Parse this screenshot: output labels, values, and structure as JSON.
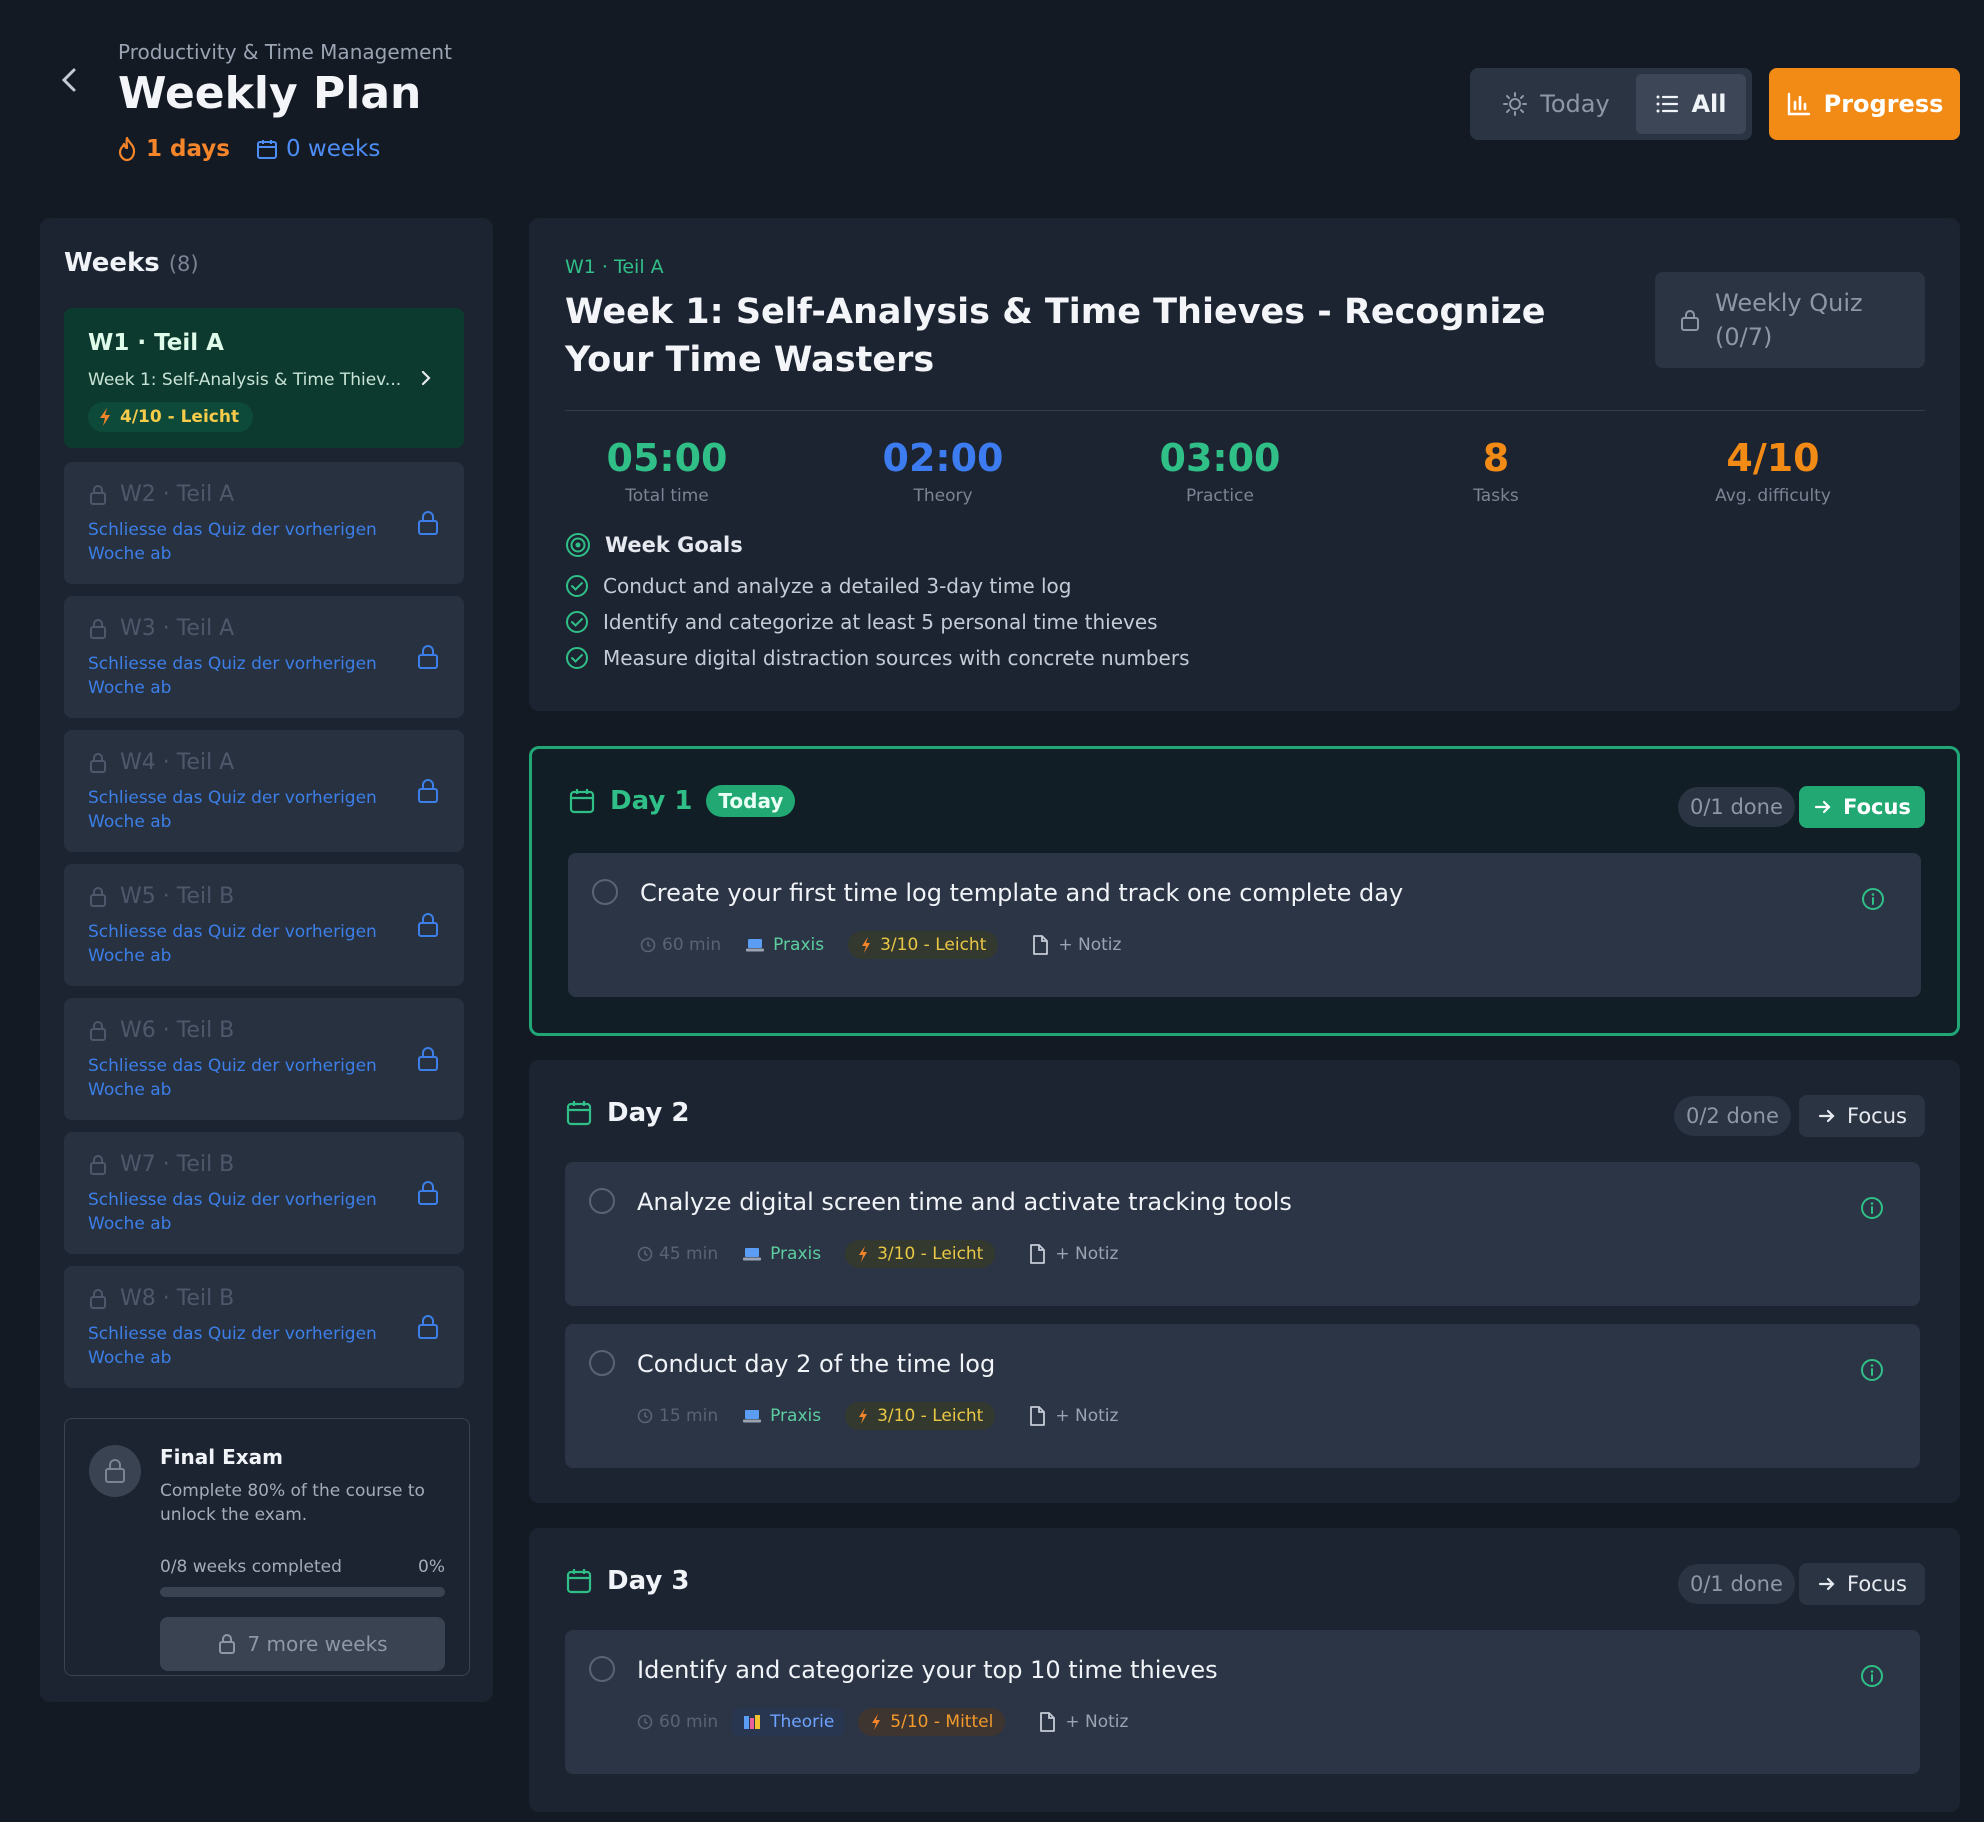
{
  "header": {
    "breadcrumb": "Productivity & Time Management",
    "title": "Weekly Plan",
    "streak_days": "1 days",
    "streak_weeks": "0 weeks",
    "toggle_today": "Today",
    "toggle_all": "All",
    "progress_label": "Progress"
  },
  "sidebar": {
    "heading": "Weeks",
    "count": "(8)",
    "active_week": {
      "title": "W1 · Teil A",
      "subtitle": "Week 1: Self-Analysis & Time Thiev...",
      "difficulty": "4/10 - Leicht"
    },
    "locked_weeks": [
      {
        "title": "W2 · Teil A",
        "desc": "Schliesse das Quiz der vorherigen Woche ab"
      },
      {
        "title": "W3 · Teil A",
        "desc": "Schliesse das Quiz der vorherigen Woche ab"
      },
      {
        "title": "W4 · Teil A",
        "desc": "Schliesse das Quiz der vorherigen Woche ab"
      },
      {
        "title": "W5 · Teil B",
        "desc": "Schliesse das Quiz der vorherigen Woche ab"
      },
      {
        "title": "W6 · Teil B",
        "desc": "Schliesse das Quiz der vorherigen Woche ab"
      },
      {
        "title": "W7 · Teil B",
        "desc": "Schliesse das Quiz der vorherigen Woche ab"
      },
      {
        "title": "W8 · Teil B",
        "desc": "Schliesse das Quiz der vorherigen Woche ab"
      }
    ],
    "final_exam": {
      "title": "Final Exam",
      "desc": "Complete 80% of the course to unlock the exam.",
      "progress_label": "0/8 weeks completed",
      "progress_pct": "0%",
      "progress_value": 0,
      "button": "7 more weeks"
    }
  },
  "overview": {
    "tag": "W1 · Teil A",
    "title": "Week 1: Self-Analysis & Time Thieves - Recognize Your Time Wasters",
    "quiz_label": "Weekly Quiz (0/7)",
    "stats": [
      {
        "value": "05:00",
        "label": "Total time",
        "color": "#2fbf87"
      },
      {
        "value": "02:00",
        "label": "Theory",
        "color": "#3d7cf0"
      },
      {
        "value": "03:00",
        "label": "Practice",
        "color": "#2fbf87"
      },
      {
        "value": "8",
        "label": "Tasks",
        "color": "#f28b16"
      },
      {
        "value": "4/10",
        "label": "Avg. difficulty",
        "color": "#f28b16"
      }
    ],
    "goals_heading": "Week Goals",
    "goals": [
      "Conduct and analyze a detailed 3-day time log",
      "Identify and categorize at least 5 personal time thieves",
      "Measure digital distraction sources with concrete numbers"
    ]
  },
  "days": [
    {
      "title": "Day 1",
      "today_badge": "Today",
      "done": "0/1 done",
      "focus": "Focus",
      "tasks": [
        {
          "title": "Create your first time log template and track one complete day",
          "time": "60 min",
          "type": "Praxis",
          "difficulty": "3/10 - Leicht",
          "note": "+ Notiz"
        }
      ]
    },
    {
      "title": "Day 2",
      "done": "0/2 done",
      "focus": "Focus",
      "tasks": [
        {
          "title": "Analyze digital screen time and activate tracking tools",
          "time": "45 min",
          "type": "Praxis",
          "difficulty": "3/10 - Leicht",
          "note": "+ Notiz"
        },
        {
          "title": "Conduct day 2 of the time log",
          "time": "15 min",
          "type": "Praxis",
          "difficulty": "3/10 - Leicht",
          "note": "+ Notiz"
        }
      ]
    },
    {
      "title": "Day 3",
      "done": "0/1 done",
      "focus": "Focus",
      "tasks": [
        {
          "title": "Identify and categorize your top 10 time thieves",
          "time": "60 min",
          "type": "Theorie",
          "difficulty": "5/10 - Mittel",
          "note": "+ Notiz"
        }
      ]
    }
  ],
  "icons": {
    "back": "chevron-left-icon",
    "streak": "flame-icon",
    "weeks": "calendar-icon",
    "today": "sun-icon",
    "all": "list-icon",
    "progress": "bar-chart-icon",
    "lock": "lock-icon",
    "goal_target": "target-icon",
    "goal_check": "check-circle-icon",
    "day": "calendar-icon",
    "focus": "arrow-right-icon",
    "info": "info-icon",
    "time": "clock-icon",
    "type_praxis": "laptop-icon",
    "type_theorie": "books-icon",
    "difficulty": "bolt-icon",
    "note": "document-icon"
  },
  "colors": {
    "background": "#141a24",
    "panel": "#1c2431",
    "accent_green": "#22a873",
    "accent_orange": "#f28b16",
    "accent_blue": "#3d7cf0"
  }
}
